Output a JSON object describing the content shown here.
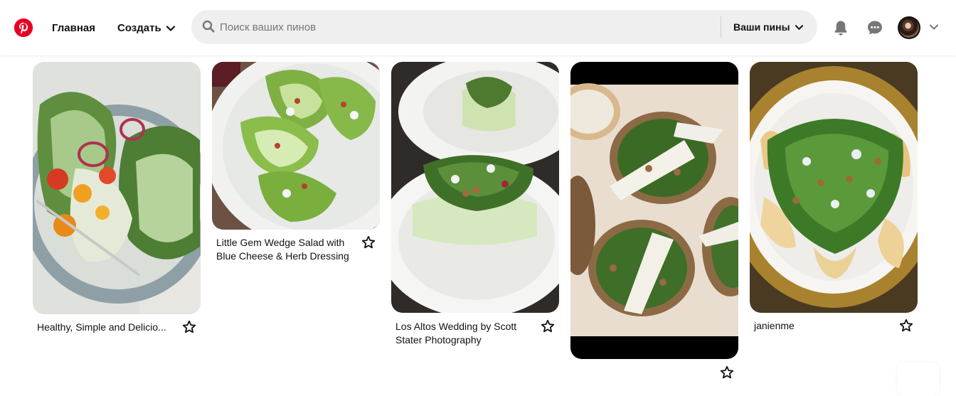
{
  "header": {
    "home_label": "Главная",
    "create_label": "Создать",
    "search_placeholder": "Поиск ваших пинов",
    "scope_label": "Ваши пины",
    "logo_icon": "pinterest-logo-icon",
    "brand_color": "#e60023"
  },
  "pins": [
    {
      "title": "Healthy, Simple and Delicio...",
      "image_icon": "wedge-salad-photo"
    },
    {
      "title": "Little Gem Wedge Salad with Blue Cheese & Herb Dressing",
      "image_icon": "little-gem-salad-photo"
    },
    {
      "title": "Los Altos Wedding by Scott Stater Photography",
      "image_icon": "cucumber-salad-photo"
    },
    {
      "title": "",
      "image_icon": "blue-cheese-toast-photo"
    },
    {
      "title": "janienme",
      "image_icon": "pear-salad-photo"
    }
  ]
}
